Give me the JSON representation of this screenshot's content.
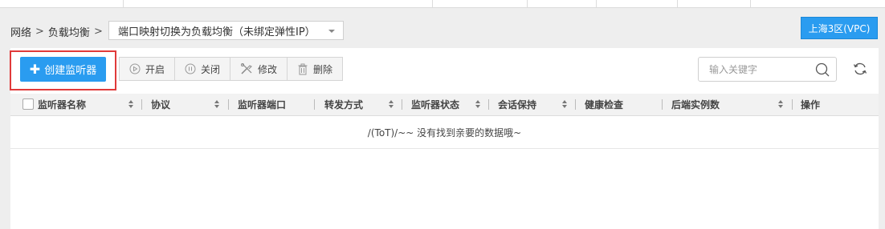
{
  "breadcrumb": {
    "items": [
      "网络",
      "负载均衡"
    ],
    "separator": ">",
    "current_select": "端口映射切换为负载均衡（未绑定弹性IP）"
  },
  "region": {
    "label": "上海3区(VPC)"
  },
  "toolbar": {
    "create_label": "创建监听器",
    "open_label": "开启",
    "close_label": "关闭",
    "modify_label": "修改",
    "delete_label": "删除"
  },
  "search": {
    "placeholder": "输入关键字",
    "value": ""
  },
  "table": {
    "columns": [
      "监听器名称",
      "协议",
      "监听器端口",
      "转发方式",
      "监听器状态",
      "会话保持",
      "健康检查",
      "后端实例数",
      "操作"
    ],
    "empty_text": "/(ToT)/~~ 没有找到亲要的数据哦~"
  },
  "colors": {
    "accent": "#2a9cf0",
    "highlight": "#e03a3a"
  }
}
